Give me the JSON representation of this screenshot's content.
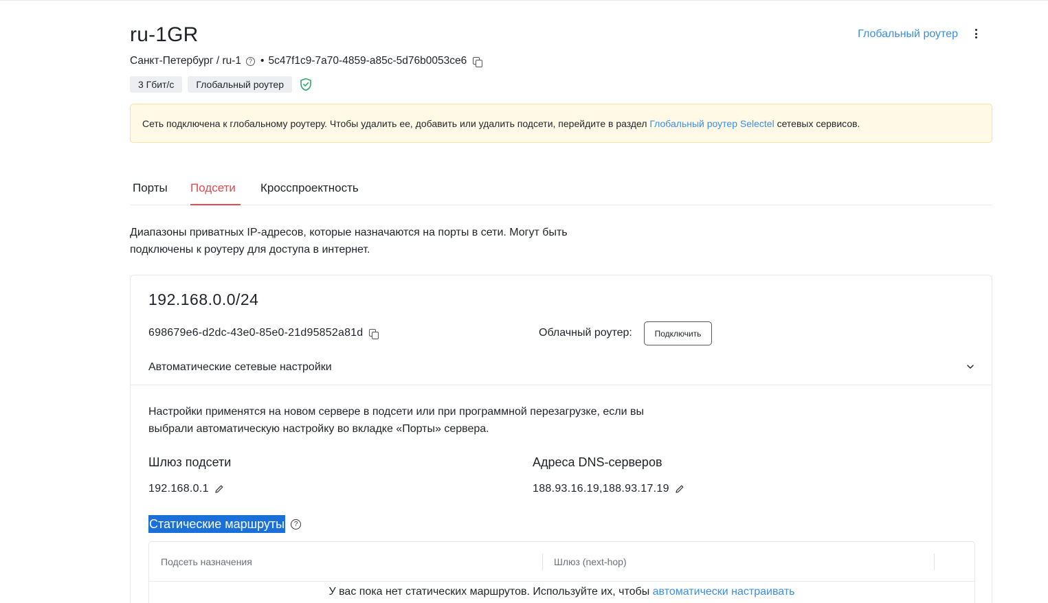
{
  "header": {
    "title": "ru-1GR",
    "global_router_link": "Глобальный роутер",
    "location": "Санкт-Петербург / ru-1",
    "separator": "•",
    "network_id": "5c47f1c9-7a70-4859-a85c-5d76b0053ce6",
    "badges": [
      "3 Гбит/с",
      "Глобальный роутер"
    ]
  },
  "notice": {
    "text_before": "Сеть подключена к глобальному роутеру. Чтобы удалить ее, добавить или удалить подсети, перейдите в раздел ",
    "link": "Глобальный роутер Selectel",
    "text_after": " сетевых сервисов."
  },
  "tabs": [
    {
      "label": "Порты",
      "active": false
    },
    {
      "label": "Подсети",
      "active": true
    },
    {
      "label": "Кросспроектность",
      "active": false
    }
  ],
  "description": "Диапазоны приватных IP-адресов, которые назначаются на порты в сети. Могут быть подключены к роутеру для доступа в интернет.",
  "subnet": {
    "cidr": "192.168.0.0/24",
    "id": "698679e6-d2dc-43e0-85e0-21d95852a81d",
    "cloud_router_label": "Облачный роутер:",
    "connect_button": "Подключить",
    "auto_settings_label": "Автоматические сетевые настройки",
    "apply_text": "Настройки применятся на новом сервере в подсети или при программной перезагрузке, если вы выбрали автоматическую настройку во вкладке «Порты» сервера.",
    "gateway_heading": "Шлюз подсети",
    "gateway_value": "192.168.0.1",
    "dns_heading": "Адреса DNS-серверов",
    "dns_value": "188.93.16.19,188.93.17.19",
    "static_routes_heading": "Статические маршруты",
    "table": {
      "columns": [
        "Подсеть назначения",
        "Шлюз (next-hop)"
      ],
      "empty_text": "У вас пока нет статических маршрутов. Используйте их, чтобы ",
      "empty_link": "автоматически настраивать"
    }
  },
  "colors": {
    "accent_link": "#3a8ee6",
    "active_tab": "#e5484d",
    "notice_bg": "#fff9e6",
    "shield": "#2fa86b",
    "selection": "#1a6fd8"
  }
}
